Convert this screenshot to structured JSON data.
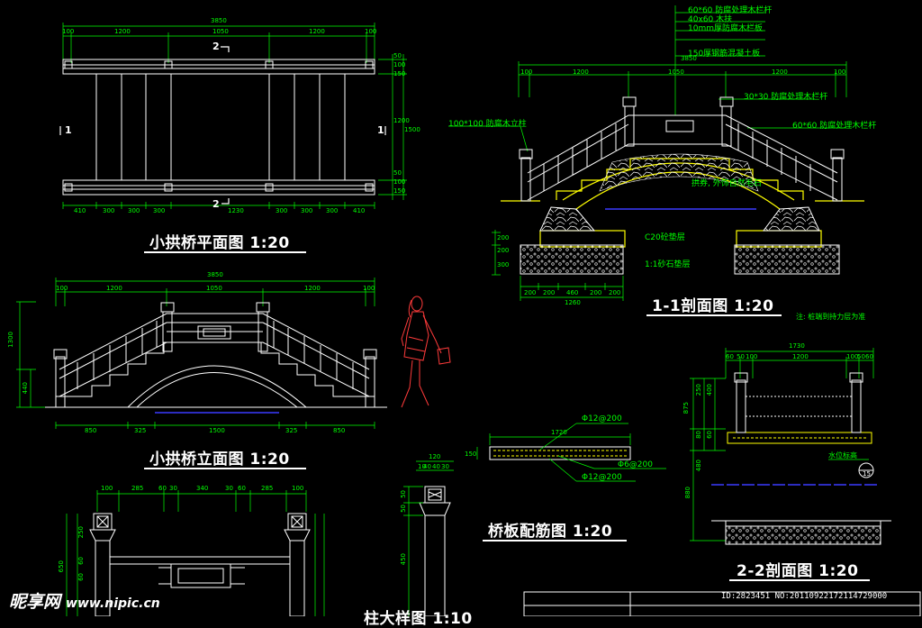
{
  "titles": {
    "plan": "小拱桥平面图 1:20",
    "elevation": "小拱桥立面图 1:20",
    "section11": "1-1剖面图 1:20",
    "section22": "2-2剖面图 1:20",
    "rebar": "桥板配筋图 1:20",
    "pillar": "柱大样图 1:10"
  },
  "plan": {
    "overall": "3850",
    "top_segments": [
      "100",
      "1200",
      "1050",
      "1200",
      "100"
    ],
    "bottom_segments": [
      "410",
      "300",
      "300",
      "300",
      "1230",
      "300",
      "300",
      "300",
      "410"
    ],
    "right_dims": [
      "50",
      "100",
      "150",
      "1200",
      "1500",
      "50",
      "100",
      "150"
    ],
    "cut_top": "2",
    "cut_bottom": "2",
    "cut_left": "1",
    "cut_right": "1"
  },
  "elevation": {
    "overall": "3850",
    "top_segments": [
      "100",
      "1200",
      "1050",
      "1200",
      "100"
    ],
    "bottom_segments": [
      "850",
      "325",
      "1500",
      "325",
      "850"
    ],
    "left_dims": [
      "1300",
      "440"
    ]
  },
  "section11": {
    "overall": "3850",
    "top_segments": [
      "100",
      "1200",
      "1050",
      "1200",
      "100"
    ],
    "callouts": [
      "60*60 防腐处理木栏杆",
      "40x60 木扶",
      "10mm厚防腐木栏板",
      "30*30 防腐处理木栏杆",
      "60*60 防腐处理木栏杆",
      "100*100 防腐木立柱",
      "150厚钢筋混凝土板"
    ],
    "arch_note": "拱券, 外饰自然毛石",
    "base_notes": [
      "C20砼垫层",
      "1:1砂石垫层"
    ],
    "bottom_segments": [
      "200",
      "200",
      "460",
      "200",
      "200"
    ],
    "bottom_total": "1260",
    "left_dims": [
      "200",
      "200",
      "300"
    ],
    "footnote": "注: 桩端到持力层为准"
  },
  "section22": {
    "overall": "1730",
    "top_segments": [
      "60",
      "50",
      "100",
      "1200",
      "100",
      "50",
      "60"
    ],
    "left_dims": [
      "875",
      "250",
      "400",
      "60",
      "80",
      "480",
      "880"
    ],
    "water_label": "水位标高",
    "marker": "15"
  },
  "rebar": {
    "length": "1720",
    "thickness": "150",
    "labels": [
      "Φ12@200",
      "Φ6@200",
      "Φ12@200"
    ]
  },
  "pillar": {
    "widths": [
      "120",
      "40",
      "40",
      "30",
      "10"
    ],
    "heights": [
      "50",
      "50",
      "450"
    ]
  },
  "detail": {
    "top_segments": [
      "100",
      "285",
      "60",
      "30",
      "340",
      "30",
      "60",
      "285",
      "100"
    ],
    "left_dims": [
      "250",
      "650",
      "60",
      "60"
    ]
  },
  "watermark": {
    "brand": "昵享网",
    "url": "www.nipic.cn",
    "id_text": "ID:2823451 NO:20110922172114729000"
  },
  "colors": {
    "background": "#000000",
    "line": "#ffffff",
    "dimension": "#00ff00",
    "highlight": "#ffff00",
    "water": "#0000ff",
    "figure": "#ff3b3b"
  }
}
